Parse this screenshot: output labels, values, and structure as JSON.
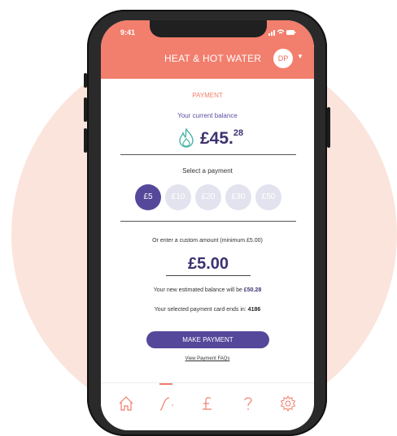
{
  "status_bar": {
    "time": "9:41"
  },
  "header": {
    "title": "HEAT & HOT WATER",
    "avatar_initials": "DP"
  },
  "payment": {
    "section_label": "PAYMENT",
    "balance_label": "Your current balance",
    "balance_pounds": "£45.",
    "balance_pence": "28",
    "select_label": "Select a payment",
    "amounts": [
      {
        "label": "£5",
        "selected": true
      },
      {
        "label": "£10",
        "selected": false
      },
      {
        "label": "£20",
        "selected": false
      },
      {
        "label": "£30",
        "selected": false
      },
      {
        "label": "£50",
        "selected": false
      }
    ],
    "custom_label": "Or enter a custom amount (minimum £5.00)",
    "custom_amount": "£5.00",
    "new_balance_text": "Your new estimated balance will be ",
    "new_balance_value": "£50.28",
    "card_text": "Your selected payment card ends in: ",
    "card_value": "4186",
    "button_label": "MAKE PAYMENT",
    "faq_label": "View Payment FAQs"
  },
  "tabs": [
    {
      "icon": "home-icon"
    },
    {
      "icon": "usage-graph-icon",
      "active": true
    },
    {
      "icon": "pound-icon"
    },
    {
      "icon": "help-icon"
    },
    {
      "icon": "settings-icon"
    }
  ],
  "colors": {
    "header": "#f27e6d",
    "accent": "#55489a",
    "text_purple": "#3d3270",
    "background_circle": "#fbe4dc"
  }
}
